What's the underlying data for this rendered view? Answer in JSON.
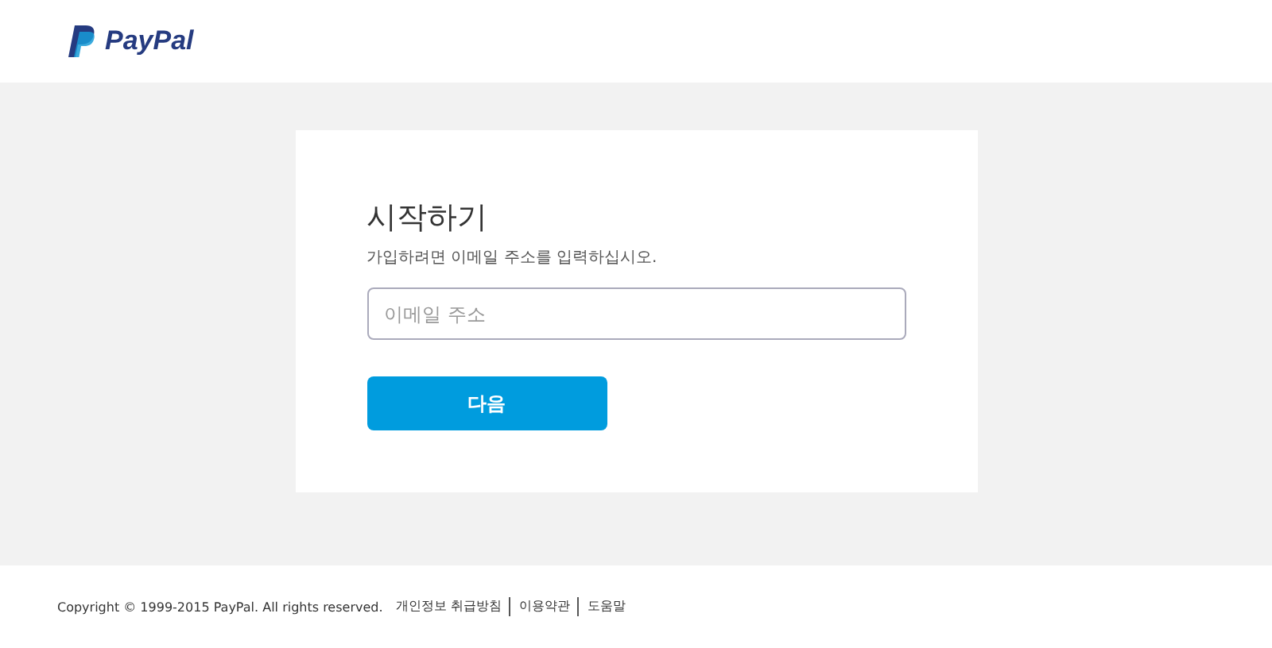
{
  "header": {
    "logo_text": "PayPal"
  },
  "card": {
    "title": "시작하기",
    "subtitle": "가입하려면 이메일 주소를 입력하십시오.",
    "email_field": {
      "placeholder": "이메일 주소"
    },
    "next_button": "다음"
  },
  "footer": {
    "copyright": "Copyright © 1999-2015 PayPal. All rights reserved.",
    "links": [
      "개인정보 취급방침",
      "이용약관",
      "도움말"
    ]
  }
}
